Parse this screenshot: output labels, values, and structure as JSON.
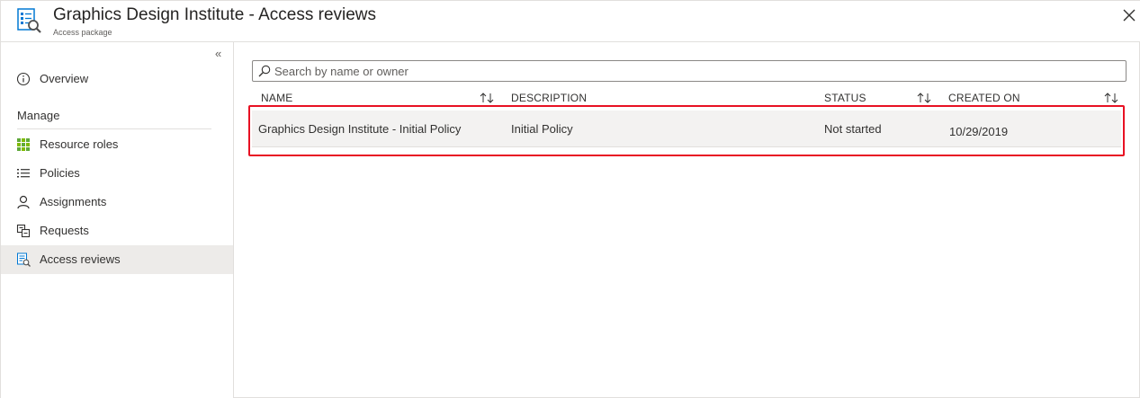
{
  "header": {
    "title": "Graphics Design Institute - Access reviews",
    "subtitle": "Access package",
    "icon": "access-reviews-icon",
    "close_icon": "close-icon"
  },
  "sidebar": {
    "collapse_glyph": "«",
    "items": [
      {
        "label": "Overview",
        "icon": "info-icon"
      },
      {
        "label": "Resource roles",
        "icon": "grid-icon"
      },
      {
        "label": "Policies",
        "icon": "list-icon"
      },
      {
        "label": "Assignments",
        "icon": "person-icon"
      },
      {
        "label": "Requests",
        "icon": "requests-icon"
      },
      {
        "label": "Access reviews",
        "icon": "access-reviews-icon",
        "active": true
      }
    ],
    "section_label": "Manage"
  },
  "search": {
    "placeholder": "Search by name or owner",
    "value": ""
  },
  "table": {
    "columns": [
      {
        "label": "NAME",
        "sortable": true
      },
      {
        "label": "DESCRIPTION",
        "sortable": false
      },
      {
        "label": "STATUS",
        "sortable": true
      },
      {
        "label": "CREATED ON",
        "sortable": true
      }
    ],
    "rows": [
      {
        "name": "Graphics Design Institute - Initial Policy",
        "description": "Initial Policy",
        "status": "Not started",
        "created_on": "10/29/2019"
      }
    ]
  },
  "colors": {
    "accent": "#0078d4",
    "highlight_border": "#e81123",
    "active_nav": "#edebe9",
    "row_selected": "#f3f2f1",
    "grid_green": "#5ea83a"
  }
}
